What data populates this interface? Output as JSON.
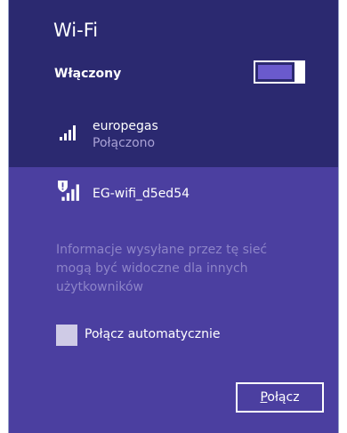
{
  "panel": {
    "title": "Wi-Fi",
    "wifi_status_label": "Włączony",
    "wifi_enabled": true
  },
  "networks": [
    {
      "name": "europegas",
      "status": "Połączono",
      "icon": "wifi-signal-icon",
      "signal_bars": 4
    },
    {
      "name": "EG-wifi_d5ed54",
      "icon": "wifi-signal-unsecured-icon",
      "signal_bars": 4
    }
  ],
  "details": {
    "security_warning": "Informacje wysyłane przez tę sieć mogą być widoczne dla innych użytkowników",
    "auto_connect_label": "Połącz automatycznie",
    "auto_connect_checked": false,
    "connect_label_first": "P",
    "connect_label_rest": "ołącz"
  },
  "colors": {
    "header_bg": "#2b2970",
    "selected_bg": "#4b3fa0",
    "secondary_text": "#a9a2d6",
    "warning_text": "#8d84c8"
  }
}
